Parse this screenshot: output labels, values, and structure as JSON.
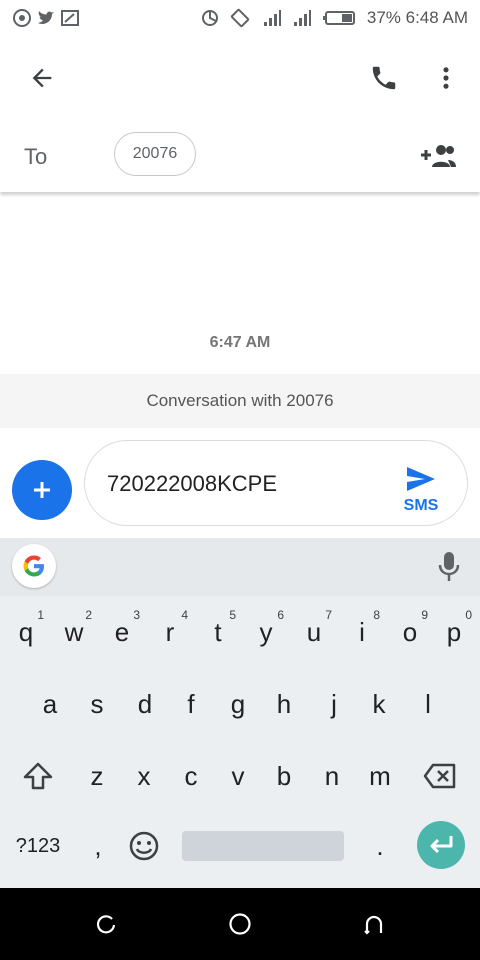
{
  "status_bar": {
    "battery": "37%",
    "time": "6:48 AM",
    "left_icons": [
      "chrome-icon",
      "twitter-icon",
      "screen-cast-icon"
    ],
    "right_icons": [
      "data-saver-icon",
      "rotate-icon",
      "signal-1-icon",
      "signal-2-icon",
      "battery-icon"
    ]
  },
  "app_bar": {
    "icons": [
      "back-arrow-icon",
      "phone-icon",
      "more-vert-icon"
    ]
  },
  "recipient": {
    "to_label": "To",
    "chip": "20076"
  },
  "conversation": {
    "timestamp": "6:47 AM",
    "banner": "Conversation with 20076"
  },
  "compose": {
    "message": "720222008KCPE",
    "send_label": "SMS"
  },
  "keyboard": {
    "row1": [
      {
        "key": "q",
        "hint": "1"
      },
      {
        "key": "w",
        "hint": "2"
      },
      {
        "key": "e",
        "hint": "3"
      },
      {
        "key": "r",
        "hint": "4"
      },
      {
        "key": "t",
        "hint": "5"
      },
      {
        "key": "y",
        "hint": "6"
      },
      {
        "key": "u",
        "hint": "7"
      },
      {
        "key": "i",
        "hint": "8"
      },
      {
        "key": "o",
        "hint": "9"
      },
      {
        "key": "p",
        "hint": "0"
      }
    ],
    "row2": [
      "a",
      "s",
      "d",
      "f",
      "g",
      "h",
      "j",
      "k",
      "l"
    ],
    "row3": [
      "z",
      "x",
      "c",
      "v",
      "b",
      "n",
      "m"
    ],
    "symbols_key": "?123",
    "comma_key": ",",
    "period_key": "."
  },
  "colors": {
    "accent": "#1a73e8",
    "enter": "#4db6ac",
    "keyboard_bg": "#eceff1"
  }
}
